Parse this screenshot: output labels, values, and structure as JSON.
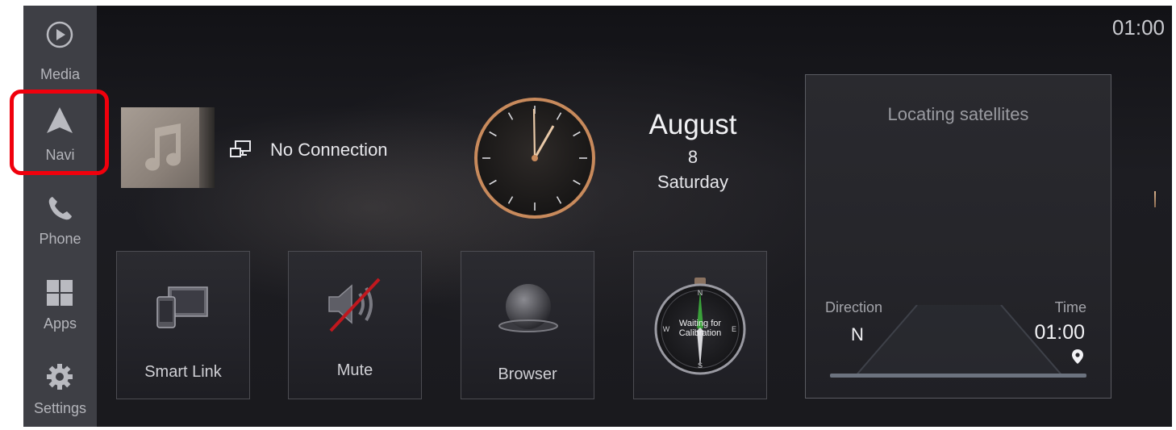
{
  "status_bar": {
    "time": "01:00"
  },
  "sidebar": {
    "items": [
      {
        "label": "Media",
        "icon": "play-circle-icon"
      },
      {
        "label": "Navi",
        "icon": "navigation-arrow-icon"
      },
      {
        "label": "Phone",
        "icon": "phone-icon"
      },
      {
        "label": "Apps",
        "icon": "apps-grid-icon"
      },
      {
        "label": "Settings",
        "icon": "gear-icon"
      }
    ],
    "highlight_color": "#f0000c"
  },
  "media_widget": {
    "status": "No Connection",
    "album_icon": "music-note-icon",
    "connection_icon": "screen-link-icon"
  },
  "date_widget": {
    "month": "August",
    "day": "8",
    "weekday": "Saturday"
  },
  "tiles": [
    {
      "label": "Smart Link",
      "icon": "smart-link-icon"
    },
    {
      "label": "Mute",
      "icon": "speaker-muted-icon"
    },
    {
      "label": "Browser",
      "icon": "globe-icon"
    },
    {
      "label": "Compass",
      "icon": "compass-icon",
      "compass_text_line1": "Waiting for",
      "compass_text_line2": "Calibration",
      "compass_letters": {
        "n": "N",
        "s": "S",
        "e": "E",
        "w": "W"
      }
    }
  ],
  "nav_widget": {
    "title": "Locating satellites",
    "direction_label": "Direction",
    "direction_value": "N",
    "time_label": "Time",
    "time_value": "01:00"
  },
  "colors": {
    "accent_copper": "#c88a5c",
    "background": "#17171b",
    "sidebar": "#3e3f45"
  }
}
